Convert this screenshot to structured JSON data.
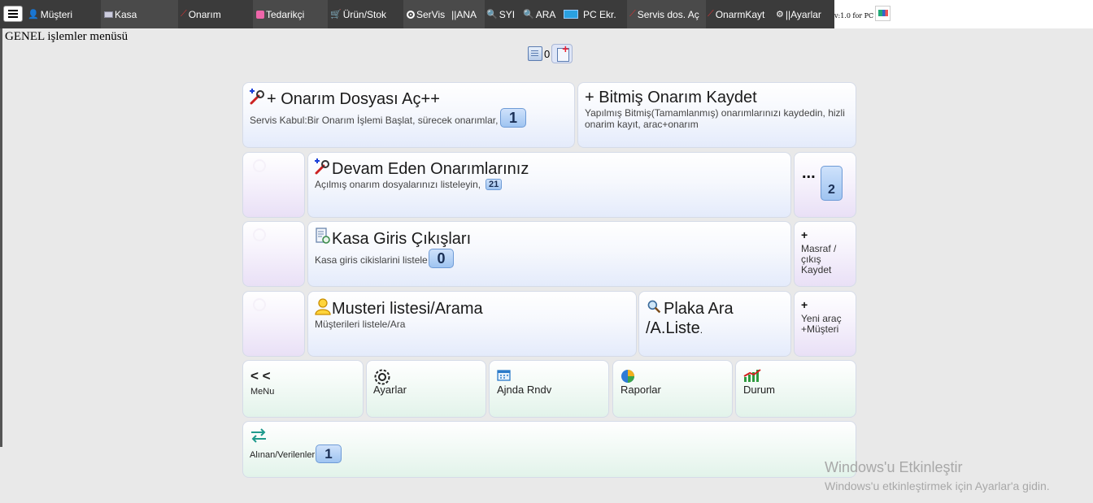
{
  "nav": {
    "items": [
      {
        "label": "Müşteri",
        "icon": "user-icon"
      },
      {
        "label": "Kasa",
        "icon": "cash-icon"
      },
      {
        "label": "Onarım",
        "icon": "wrench-icon"
      },
      {
        "label": "Tedarikçi",
        "icon": "supplier-icon"
      },
      {
        "label": "Ürün/Stok",
        "icon": "cart-icon"
      },
      {
        "label": "SerVis",
        "icon": "service-icon"
      },
      {
        "label": "||ANA",
        "icon": ""
      },
      {
        "label": "SYI",
        "icon": "search-icon"
      },
      {
        "label": "ARA",
        "icon": "search-icon"
      },
      {
        "label": "PC Ekr.",
        "icon": "monitor-icon"
      },
      {
        "label": "Servis dos. Aç",
        "icon": "wrench-icon"
      },
      {
        "label": "OnarmKayt",
        "icon": "wrench-icon"
      },
      {
        "label": "||Ayarlar",
        "icon": "gear-icon"
      }
    ],
    "version": "v:1.0 for PC"
  },
  "page": {
    "title": "GENEL işlemler menüsü",
    "top_count": "0"
  },
  "cards": {
    "open_repair": {
      "title": "+ Onarım Dosyası Aç++",
      "subtitle": "Servis Kabul:Bir Onarım İşlemi Başlat, sürecek onarımlar,",
      "badge": "1"
    },
    "finished_repair": {
      "title": "+ Bitmiş Onarım Kaydet",
      "subtitle": "Yapılmış Bitmiş(Tamamlanmış) onarımlarınızı kaydedin, hizli onarim kayıt, arac+onarım"
    },
    "ongoing": {
      "title": "Devam Eden Onarımlarınız",
      "subtitle": "Açılmış onarım dosyalarınızı listeleyin,",
      "badge": "21"
    },
    "ongoing_more": {
      "dots": "...",
      "badge": "2"
    },
    "cash": {
      "title": "Kasa Giris Çıkışları",
      "subtitle": "Kasa giris cikislarini listele",
      "badge": "0"
    },
    "expense": {
      "plus": "+",
      "label": "Masraf / çıkış Kaydet"
    },
    "customers": {
      "title": "Musteri listesi/Arama",
      "subtitle": "Müşterileri listele/Ara"
    },
    "plate": {
      "title_a": "Plaka Ara",
      "title_b": "/A.Liste",
      "dot": "."
    },
    "new_vehicle": {
      "plus": "+",
      "label": "Yeni araç +Müşteri"
    },
    "menu": {
      "arrows": "< <",
      "label": "MeNu"
    },
    "settings": {
      "label": "Ayarlar"
    },
    "agenda": {
      "label": "Ajnda Rndv"
    },
    "reports": {
      "label": "Raporlar"
    },
    "status": {
      "label": "Durum"
    },
    "exchange": {
      "label": "Alınan/Verilenler",
      "badge": "1"
    }
  },
  "watermark": {
    "line1": "Windows'u Etkinleştir",
    "line2": "Windows'u etkinleştirmek için Ayarlar'a gidin."
  }
}
